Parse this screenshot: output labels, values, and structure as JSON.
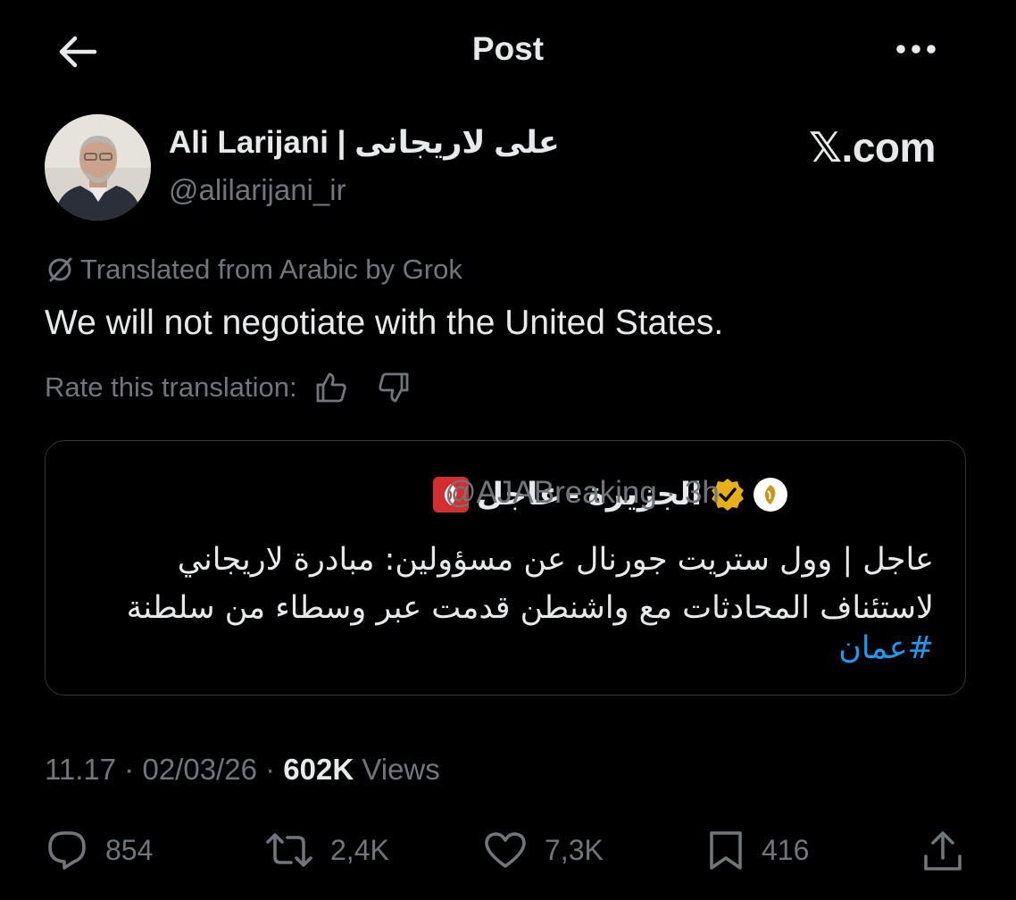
{
  "header": {
    "title": "Post",
    "back_icon": "arrow-left-icon",
    "more_icon": "more-horizontal-icon"
  },
  "author": {
    "name": "Ali Larijani | علی لاریجانی",
    "handle": "@alilarijani_ir",
    "avatar_icon": "avatar"
  },
  "watermark": "𝕏.com",
  "translation": {
    "label": "Translated from Arabic by Grok",
    "text": "We will not negotiate with the United States.",
    "rate_label": "Rate this translation:"
  },
  "quote": {
    "name": "الجزيرة - عاجل",
    "handle": "@AJABreaking",
    "time": "3h",
    "body": "عاجل | وول ستريت جورنال عن مسؤولين: مبادرة لاريجاني لاستئناف المحادثات مع واشنطن قدمت عبر وسطاء من سلطنة",
    "hashtag": "#عمان",
    "verified_color": "#e8b017"
  },
  "meta": {
    "time": "11.17",
    "date": "02/03/26",
    "views_count": "602K",
    "views_label": "Views"
  },
  "actions": {
    "replies": "854",
    "reposts": "2,4K",
    "likes": "7,3K",
    "bookmarks": "416"
  },
  "colors": {
    "background": "#000000",
    "text": "#e7e9ea",
    "secondary": "#71767b",
    "link": "#1d9bf0",
    "border": "#2f3336"
  }
}
